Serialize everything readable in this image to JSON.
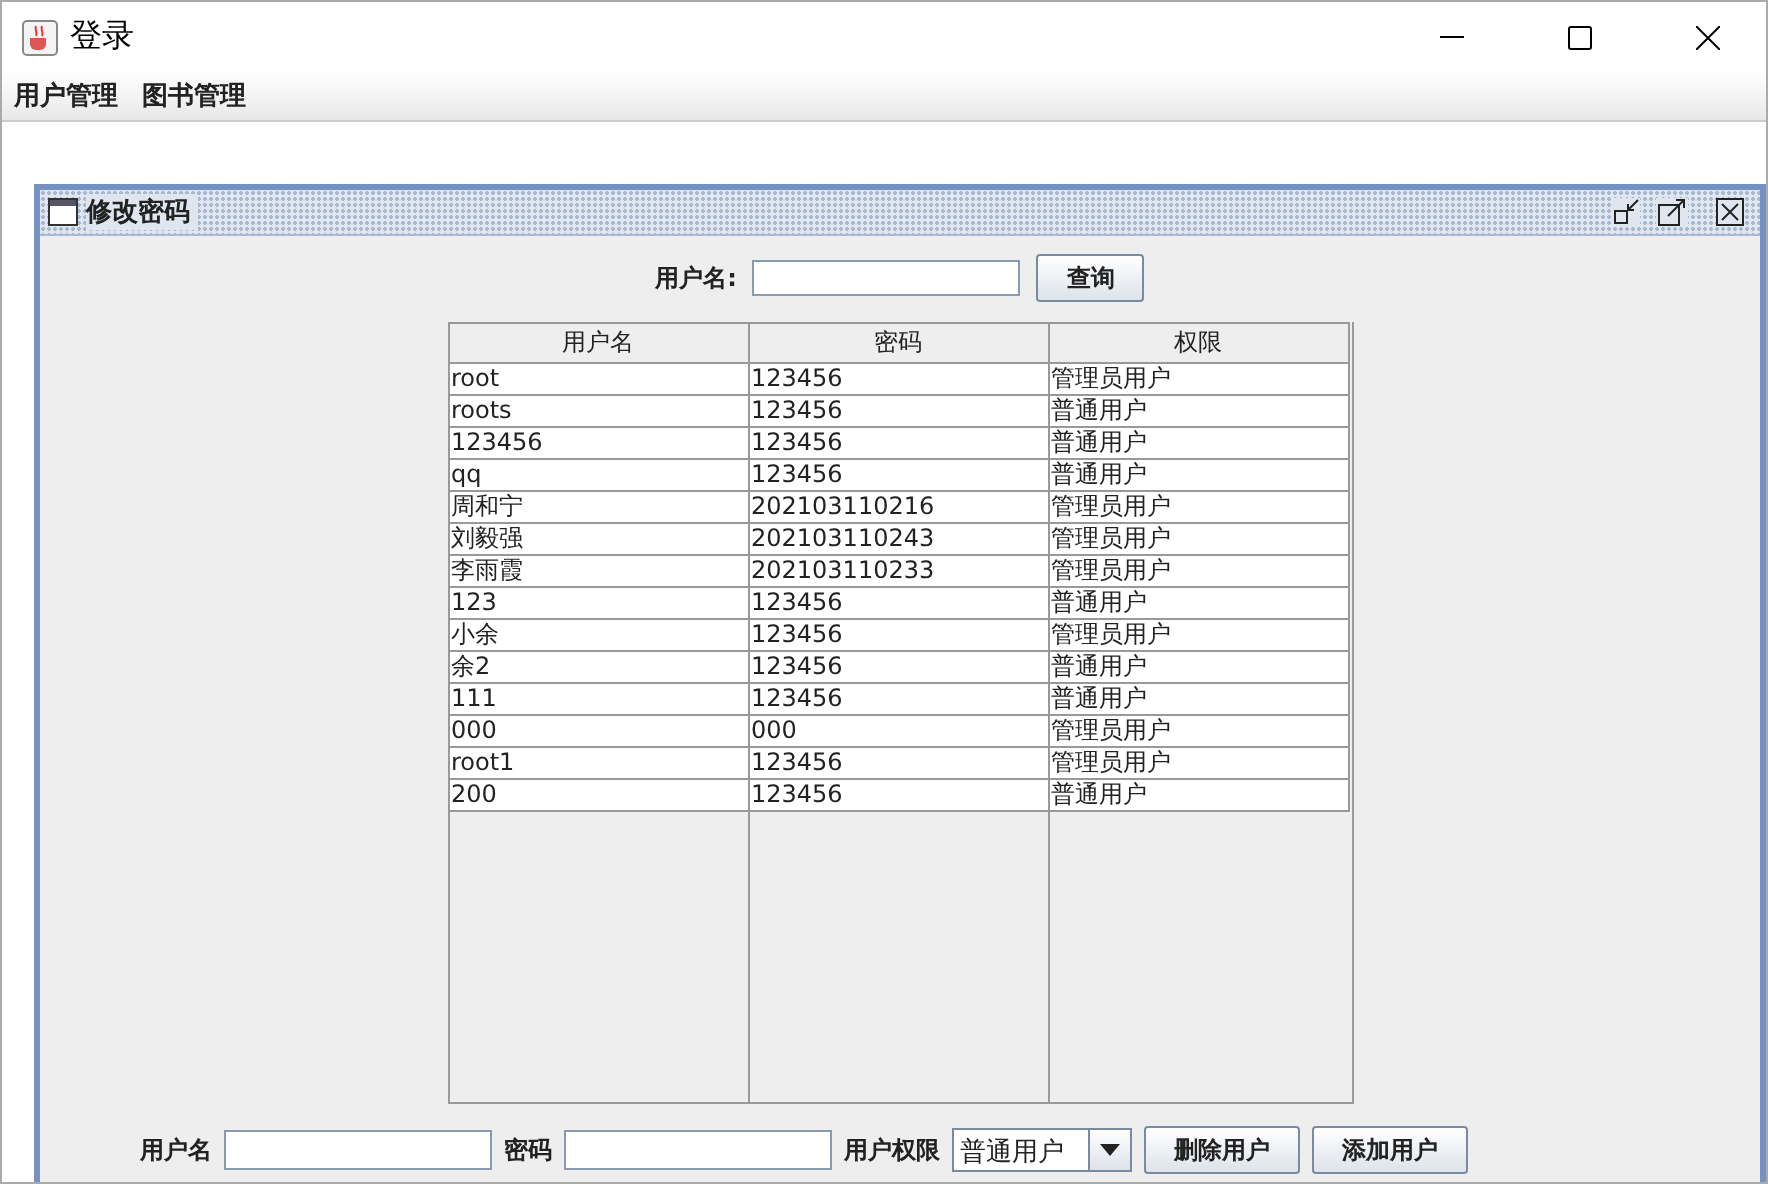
{
  "window": {
    "title": "登录"
  },
  "menu": [
    "用户管理",
    "图书管理"
  ],
  "internal_frame": {
    "title": "修改密码"
  },
  "search": {
    "label": "用户名:",
    "button": "查询"
  },
  "table": {
    "columns": [
      "用户名",
      "密码",
      "权限"
    ],
    "rows": [
      [
        "root",
        "123456",
        "管理员用户"
      ],
      [
        "roots",
        "123456",
        "普通用户"
      ],
      [
        "123456",
        "123456",
        "普通用户"
      ],
      [
        "qq",
        "123456",
        "普通用户"
      ],
      [
        "周和宁",
        "202103110216",
        "管理员用户"
      ],
      [
        "刘毅强",
        "202103110243",
        "管理员用户"
      ],
      [
        "李雨霞",
        "202103110233",
        "管理员用户"
      ],
      [
        "123",
        "123456",
        "普通用户"
      ],
      [
        "小余",
        "123456",
        "管理员用户"
      ],
      [
        "余2",
        "123456",
        "普通用户"
      ],
      [
        "111",
        "123456",
        "普通用户"
      ],
      [
        "000",
        "000",
        "管理员用户"
      ],
      [
        "root1",
        "123456",
        "管理员用户"
      ],
      [
        "200",
        "123456",
        "普通用户"
      ]
    ]
  },
  "form": {
    "username_label": "用户名",
    "password_label": "密码",
    "role_label": "用户权限",
    "role_value": "普通用户",
    "buttons": [
      "删除用户",
      "添加用户"
    ]
  }
}
